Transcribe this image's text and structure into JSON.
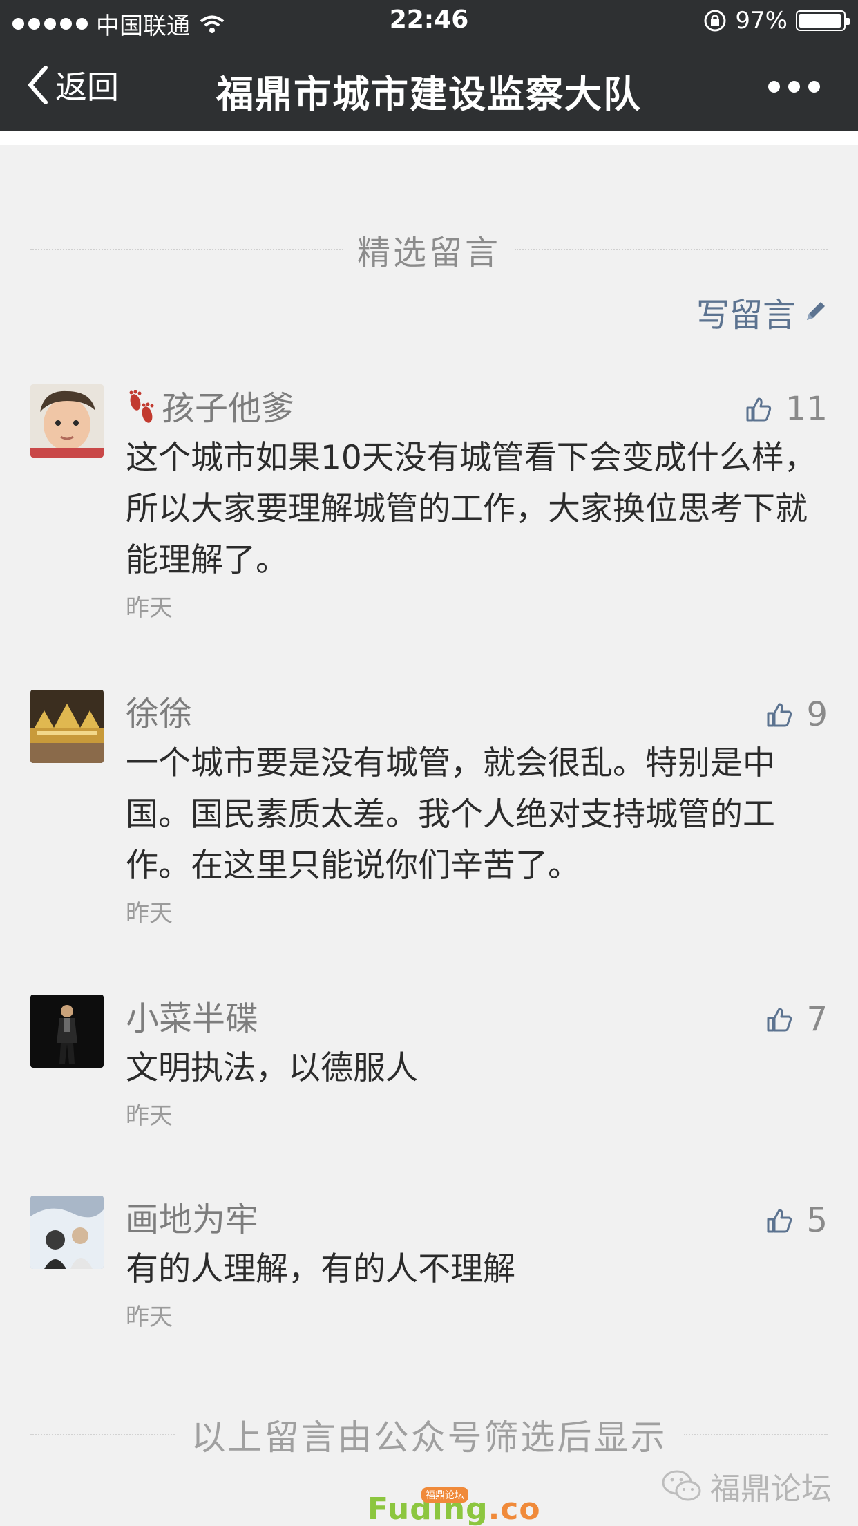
{
  "status_bar": {
    "carrier": "中国联通",
    "time": "22:46",
    "battery": "97%",
    "battery_level": 0.97
  },
  "nav": {
    "back_label": "返回",
    "title": "福鼎市城市建设监察大队"
  },
  "section": {
    "title": "精选留言",
    "write_label": "写留言"
  },
  "comments": [
    {
      "name": "孩子他爹",
      "likes": "11",
      "text": "这个城市如果10天没有城管看下会变成什么样，所以大家要理解城管的工作，大家换位思考下就能理解了。",
      "time": "昨天"
    },
    {
      "name": "徐徐",
      "likes": "9",
      "text": "一个城市要是没有城管，就会很乱。特别是中国。国民素质太差。我个人绝对支持城管的工作。在这里只能说你们辛苦了。",
      "time": "昨天"
    },
    {
      "name": "小菜半碟",
      "likes": "7",
      "text": "文明执法，以德服人",
      "time": "昨天"
    },
    {
      "name": "画地为牢",
      "likes": "5",
      "text": "有的人理解，有的人不理解",
      "time": "昨天"
    }
  ],
  "footer": {
    "note": "以上留言由公众号筛选后显示"
  },
  "watermarks": {
    "right": "福鼎论坛",
    "center_main": "Fuding",
    "center_suffix": ".co",
    "center_badge": "福鼎论坛"
  },
  "colors": {
    "nav_bg": "#2e3032",
    "page_bg": "#f1f1f1",
    "link": "#5c7390"
  }
}
